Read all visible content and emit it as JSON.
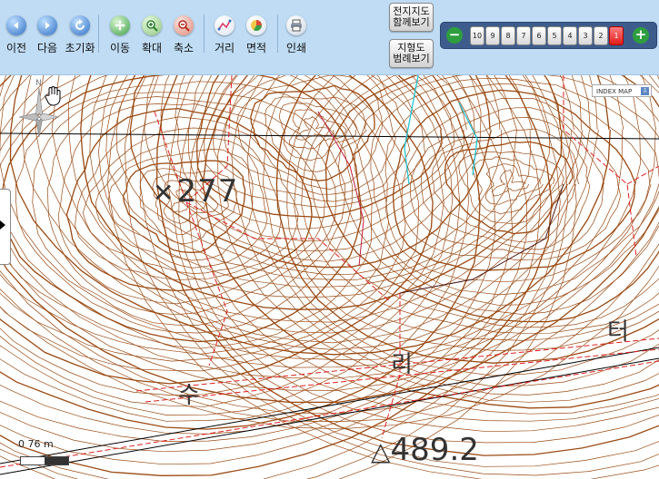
{
  "toolbar": {
    "buttons": [
      {
        "label": "이전",
        "icon": "back-arrow-icon",
        "color": "#2f6fc6"
      },
      {
        "label": "다음",
        "icon": "forward-arrow-icon",
        "color": "#2f6fc6"
      },
      {
        "label": "초기화",
        "icon": "refresh-icon",
        "color": "#2f6fc6"
      },
      {
        "label": "이동",
        "icon": "move-icon",
        "color": "#3aa047"
      },
      {
        "label": "확대",
        "icon": "zoom-in-icon",
        "color": "#3aa047"
      },
      {
        "label": "축소",
        "icon": "zoom-out-icon",
        "color": "#d8413a"
      },
      {
        "label": "거리",
        "icon": "distance-icon",
        "color": "#e05a8a"
      },
      {
        "label": "면적",
        "icon": "area-icon",
        "color": "#6aa84f"
      },
      {
        "label": "인쇄",
        "icon": "print-icon",
        "color": "#6b7c93"
      }
    ],
    "cadastral_button": {
      "line1": "전지지도",
      "line2": "함께보기"
    },
    "topo_button": {
      "line1": "지형도",
      "line2": "범례보기"
    },
    "zoom_levels": [
      "10",
      "9",
      "8",
      "7",
      "6",
      "5",
      "4",
      "3",
      "2",
      "1"
    ],
    "active_level": "1",
    "zoom_out_symbol": "−",
    "zoom_in_symbol": "+"
  },
  "map": {
    "index_map_label": "INDEX MAP",
    "index_map_arrow": "⇩",
    "north_label": "N",
    "scale_text": "0  76 m",
    "labels": [
      "277",
      "489.2",
      "수",
      "리",
      "터"
    ],
    "colors": {
      "contour": "#9a4a12",
      "road": "#e02020",
      "stream": "#22c6d6",
      "grid": "#000000"
    }
  }
}
